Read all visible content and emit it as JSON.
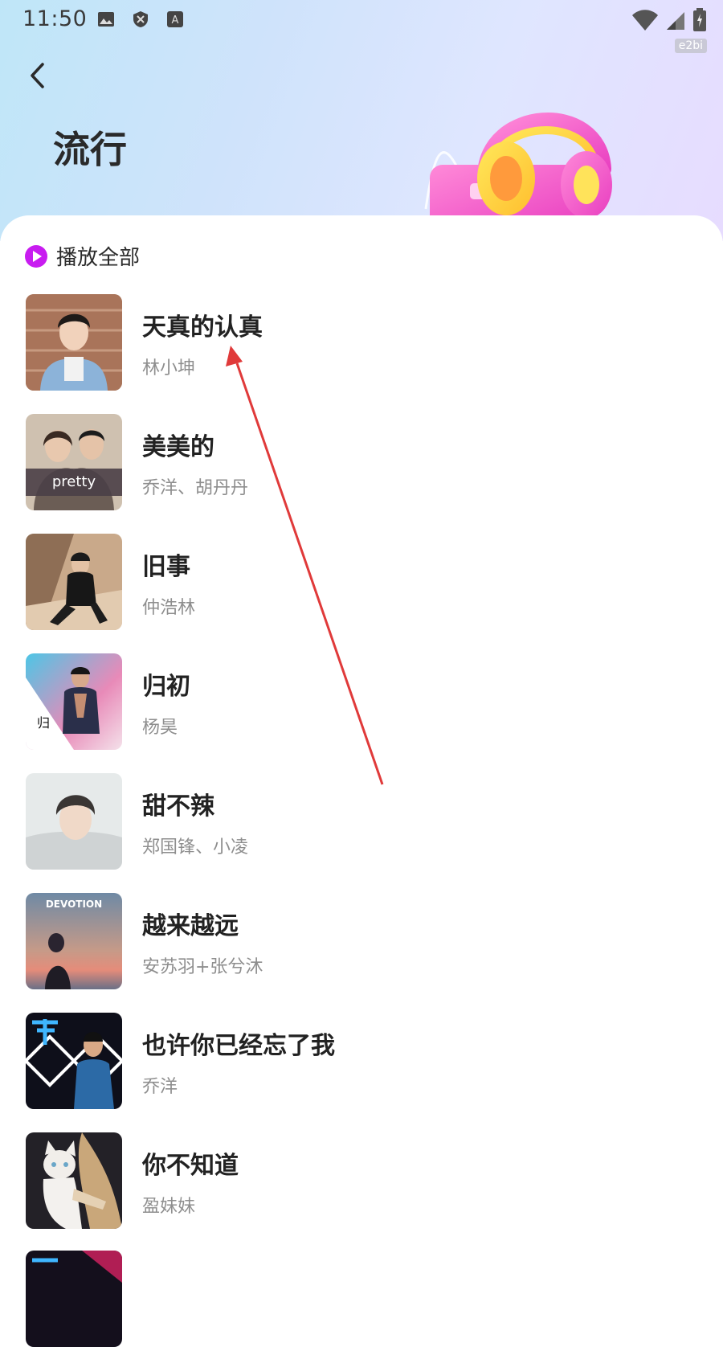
{
  "status_bar": {
    "time": "11:50",
    "icons": [
      "image-icon",
      "shield-icon",
      "text-a-icon",
      "wifi-icon",
      "signal-icon",
      "battery-icon"
    ],
    "tag": "e2bi"
  },
  "header": {
    "title": "流行",
    "back_icon": "chevron-left-icon",
    "illustration": "headphones-radio-illustration"
  },
  "play_all": {
    "label": "播放全部",
    "icon": "play-circle-icon",
    "accent": "#c81cf0"
  },
  "songs": [
    {
      "title": "天真的认真",
      "artist": "林小坤"
    },
    {
      "title": "美美的",
      "artist": "乔洋、胡丹丹",
      "cover_text": "pretty"
    },
    {
      "title": "旧事",
      "artist": "仲浩林"
    },
    {
      "title": "归初",
      "artist": "杨昊"
    },
    {
      "title": "甜不辣",
      "artist": "郑国锋、小凌"
    },
    {
      "title": "越来越远",
      "artist": "安苏羽+张兮沐",
      "cover_text": "DEVOTION"
    },
    {
      "title": "也许你已经忘了我",
      "artist": "乔洋"
    },
    {
      "title": "你不知道",
      "artist": "盈妹妹"
    }
  ],
  "colors": {
    "title_text": "#222222",
    "artist_text": "#8e8e8e",
    "annotation_arrow": "#e03a3a"
  }
}
